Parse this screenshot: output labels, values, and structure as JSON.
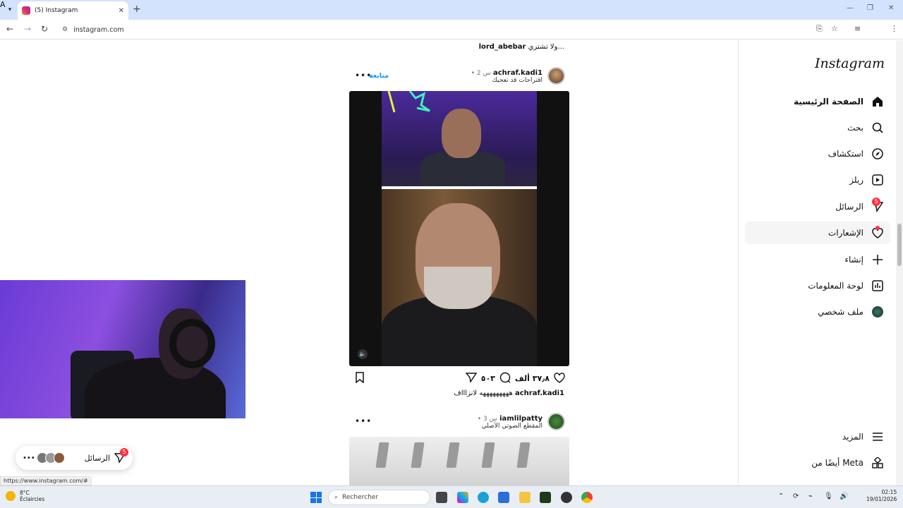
{
  "browser": {
    "tab_title": "(5) Instagram",
    "url": "instagram.com",
    "status_url": "https://www.instagram.com/#",
    "profile_initial": "A"
  },
  "sidebar": {
    "logo": "Instagram",
    "items": [
      {
        "label": "الصفحة الرئيسية",
        "icon": "home-icon"
      },
      {
        "label": "بحث",
        "icon": "search-icon"
      },
      {
        "label": "استكشاف",
        "icon": "explore-icon"
      },
      {
        "label": "ريلز",
        "icon": "reels-icon"
      },
      {
        "label": "الرسائل",
        "icon": "messages-icon",
        "badge": "5"
      },
      {
        "label": "الإشعارات",
        "icon": "heart-icon"
      },
      {
        "label": "إنشاء",
        "icon": "plus-icon"
      },
      {
        "label": "لوحة المعلومات",
        "icon": "dashboard-icon"
      },
      {
        "label": "ملف شخصي",
        "icon": "profile-avatar"
      }
    ],
    "bottom": [
      {
        "label": "المزيد",
        "icon": "menu-icon"
      },
      {
        "label": "أيضًا من Meta",
        "icon": "meta-apps-icon"
      }
    ]
  },
  "feed": {
    "prev_caption_user": "lord_abebar",
    "prev_caption_text": "ولا تشتري...",
    "post1": {
      "username": "achraf.kadi1",
      "time": "• 2 س",
      "subtitle": "اقتراحات قد تعجبك",
      "follow": "متابعة",
      "likes": "٣٧٫٨ ألف",
      "comments": "٥٠٣",
      "caption_user": "achraf.kadi1",
      "caption_text": "هههههههههه لانزاااف"
    },
    "post2": {
      "username": "iamlilpatty",
      "time": "• 3 س",
      "subtitle": "المقطع الصوتي الأصلي"
    }
  },
  "messages_pill": {
    "label": "الرسائل",
    "badge": "5"
  },
  "taskbar": {
    "temp": "8°C",
    "weather": "Éclaircies",
    "search_placeholder": "Rechercher",
    "time": "02:15",
    "date": "19/01/2026"
  }
}
